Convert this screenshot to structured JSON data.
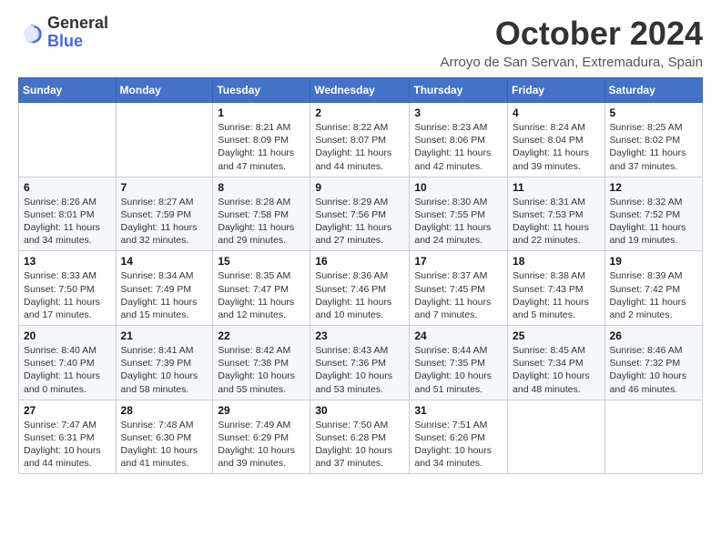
{
  "logo": {
    "line1": "General",
    "line2": "Blue"
  },
  "title": "October 2024",
  "subtitle": "Arroyo de San Servan, Extremadura, Spain",
  "header_days": [
    "Sunday",
    "Monday",
    "Tuesday",
    "Wednesday",
    "Thursday",
    "Friday",
    "Saturday"
  ],
  "weeks": [
    [
      {
        "day": "",
        "info": ""
      },
      {
        "day": "",
        "info": ""
      },
      {
        "day": "1",
        "info": "Sunrise: 8:21 AM\nSunset: 8:09 PM\nDaylight: 11 hours and 47 minutes."
      },
      {
        "day": "2",
        "info": "Sunrise: 8:22 AM\nSunset: 8:07 PM\nDaylight: 11 hours and 44 minutes."
      },
      {
        "day": "3",
        "info": "Sunrise: 8:23 AM\nSunset: 8:06 PM\nDaylight: 11 hours and 42 minutes."
      },
      {
        "day": "4",
        "info": "Sunrise: 8:24 AM\nSunset: 8:04 PM\nDaylight: 11 hours and 39 minutes."
      },
      {
        "day": "5",
        "info": "Sunrise: 8:25 AM\nSunset: 8:02 PM\nDaylight: 11 hours and 37 minutes."
      }
    ],
    [
      {
        "day": "6",
        "info": "Sunrise: 8:26 AM\nSunset: 8:01 PM\nDaylight: 11 hours and 34 minutes."
      },
      {
        "day": "7",
        "info": "Sunrise: 8:27 AM\nSunset: 7:59 PM\nDaylight: 11 hours and 32 minutes."
      },
      {
        "day": "8",
        "info": "Sunrise: 8:28 AM\nSunset: 7:58 PM\nDaylight: 11 hours and 29 minutes."
      },
      {
        "day": "9",
        "info": "Sunrise: 8:29 AM\nSunset: 7:56 PM\nDaylight: 11 hours and 27 minutes."
      },
      {
        "day": "10",
        "info": "Sunrise: 8:30 AM\nSunset: 7:55 PM\nDaylight: 11 hours and 24 minutes."
      },
      {
        "day": "11",
        "info": "Sunrise: 8:31 AM\nSunset: 7:53 PM\nDaylight: 11 hours and 22 minutes."
      },
      {
        "day": "12",
        "info": "Sunrise: 8:32 AM\nSunset: 7:52 PM\nDaylight: 11 hours and 19 minutes."
      }
    ],
    [
      {
        "day": "13",
        "info": "Sunrise: 8:33 AM\nSunset: 7:50 PM\nDaylight: 11 hours and 17 minutes."
      },
      {
        "day": "14",
        "info": "Sunrise: 8:34 AM\nSunset: 7:49 PM\nDaylight: 11 hours and 15 minutes."
      },
      {
        "day": "15",
        "info": "Sunrise: 8:35 AM\nSunset: 7:47 PM\nDaylight: 11 hours and 12 minutes."
      },
      {
        "day": "16",
        "info": "Sunrise: 8:36 AM\nSunset: 7:46 PM\nDaylight: 11 hours and 10 minutes."
      },
      {
        "day": "17",
        "info": "Sunrise: 8:37 AM\nSunset: 7:45 PM\nDaylight: 11 hours and 7 minutes."
      },
      {
        "day": "18",
        "info": "Sunrise: 8:38 AM\nSunset: 7:43 PM\nDaylight: 11 hours and 5 minutes."
      },
      {
        "day": "19",
        "info": "Sunrise: 8:39 AM\nSunset: 7:42 PM\nDaylight: 11 hours and 2 minutes."
      }
    ],
    [
      {
        "day": "20",
        "info": "Sunrise: 8:40 AM\nSunset: 7:40 PM\nDaylight: 11 hours and 0 minutes."
      },
      {
        "day": "21",
        "info": "Sunrise: 8:41 AM\nSunset: 7:39 PM\nDaylight: 10 hours and 58 minutes."
      },
      {
        "day": "22",
        "info": "Sunrise: 8:42 AM\nSunset: 7:38 PM\nDaylight: 10 hours and 55 minutes."
      },
      {
        "day": "23",
        "info": "Sunrise: 8:43 AM\nSunset: 7:36 PM\nDaylight: 10 hours and 53 minutes."
      },
      {
        "day": "24",
        "info": "Sunrise: 8:44 AM\nSunset: 7:35 PM\nDaylight: 10 hours and 51 minutes."
      },
      {
        "day": "25",
        "info": "Sunrise: 8:45 AM\nSunset: 7:34 PM\nDaylight: 10 hours and 48 minutes."
      },
      {
        "day": "26",
        "info": "Sunrise: 8:46 AM\nSunset: 7:32 PM\nDaylight: 10 hours and 46 minutes."
      }
    ],
    [
      {
        "day": "27",
        "info": "Sunrise: 7:47 AM\nSunset: 6:31 PM\nDaylight: 10 hours and 44 minutes."
      },
      {
        "day": "28",
        "info": "Sunrise: 7:48 AM\nSunset: 6:30 PM\nDaylight: 10 hours and 41 minutes."
      },
      {
        "day": "29",
        "info": "Sunrise: 7:49 AM\nSunset: 6:29 PM\nDaylight: 10 hours and 39 minutes."
      },
      {
        "day": "30",
        "info": "Sunrise: 7:50 AM\nSunset: 6:28 PM\nDaylight: 10 hours and 37 minutes."
      },
      {
        "day": "31",
        "info": "Sunrise: 7:51 AM\nSunset: 6:26 PM\nDaylight: 10 hours and 34 minutes."
      },
      {
        "day": "",
        "info": ""
      },
      {
        "day": "",
        "info": ""
      }
    ]
  ]
}
